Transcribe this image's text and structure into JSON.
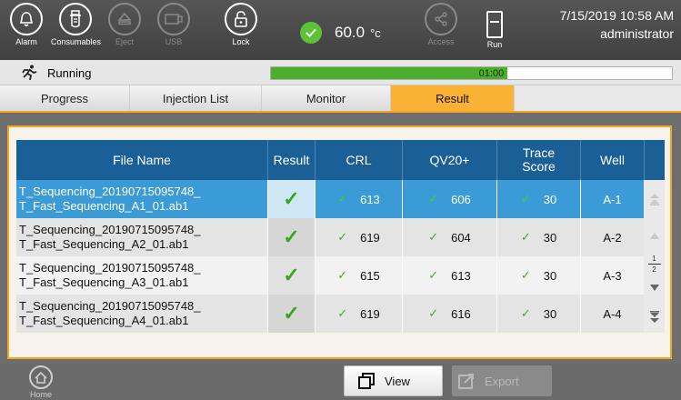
{
  "toolbar": {
    "alarm_label": "Alarm",
    "consumables_label": "Consumables",
    "eject_label": "Eject",
    "usb_label": "USB",
    "lock_label": "Lock",
    "temperature_value": "60.0",
    "temperature_unit": "°c",
    "access_label": "Access",
    "run_label": "Run",
    "datetime": "7/15/2019 10:58 AM",
    "user": "administrator"
  },
  "status": {
    "state_label": "Running",
    "progress_time": "01:00",
    "progress_fraction": 0.59
  },
  "tabs": [
    {
      "label": "Progress",
      "active": false
    },
    {
      "label": "Injection List",
      "active": false
    },
    {
      "label": "Monitor",
      "active": false
    },
    {
      "label": "Result",
      "active": true
    }
  ],
  "table": {
    "headers": {
      "file_name": "File Name",
      "result": "Result",
      "crl": "CRL",
      "qv20": "QV20+",
      "trace_score": "Trace\nScore",
      "well": "Well"
    },
    "rows": [
      {
        "file_name": "T_Sequencing_20190715095748_\nT_Fast_Sequencing_A1_01.ab1",
        "crl": "613",
        "qv20": "606",
        "trace_score": "30",
        "well": "A-1",
        "selected": true
      },
      {
        "file_name": "T_Sequencing_20190715095748_\nT_Fast_Sequencing_A2_01.ab1",
        "crl": "619",
        "qv20": "604",
        "trace_score": "30",
        "well": "A-2",
        "selected": false
      },
      {
        "file_name": "T_Sequencing_20190715095748_\nT_Fast_Sequencing_A3_01.ab1",
        "crl": "615",
        "qv20": "613",
        "trace_score": "30",
        "well": "A-3",
        "selected": false
      },
      {
        "file_name": "T_Sequencing_20190715095748_\nT_Fast_Sequencing_A4_01.ab1",
        "crl": "619",
        "qv20": "616",
        "trace_score": "30",
        "well": "A-4",
        "selected": false
      }
    ],
    "page_current": "1",
    "page_total": "2"
  },
  "bottom": {
    "home_label": "Home",
    "view_label": "View",
    "export_label": "Export"
  },
  "colors": {
    "accent": "#f9b233",
    "header_blue": "#1a5f96",
    "selected_row": "#3a9bd6",
    "ok_green": "#4cae2b"
  }
}
